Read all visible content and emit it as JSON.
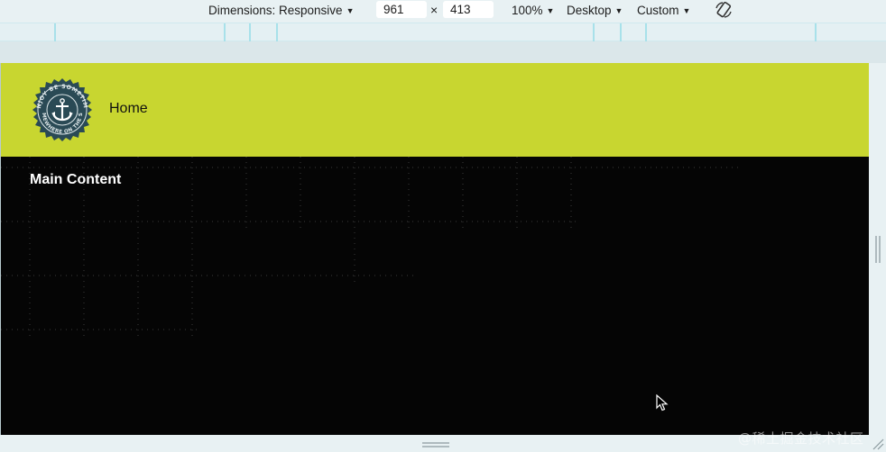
{
  "toolbar": {
    "dimensions_label": "Dimensions: Responsive",
    "width_value": "961",
    "times": "×",
    "height_value": "413",
    "zoom": "100%",
    "device": "Desktop",
    "throttle": "Custom",
    "caret": "▼"
  },
  "page": {
    "nav_home": "Home",
    "main_title": "Main Content",
    "logo_text_top": "ENJOY BE SOMETIME",
    "logo_text_bottom": "SOMEWHERE ON THE SEA"
  },
  "watermark": "@稀土掘金技术社区",
  "colors": {
    "header_bg": "#c8d630",
    "content_bg": "#050505",
    "logo_bg": "#2a4a55",
    "toolbar_bg": "#e8f1f3",
    "ruler_line": "#a8e1ea"
  },
  "icons": [
    "rotate-icon",
    "anchor-icon",
    "resize-handle-icon",
    "mouse-cursor-icon"
  ]
}
